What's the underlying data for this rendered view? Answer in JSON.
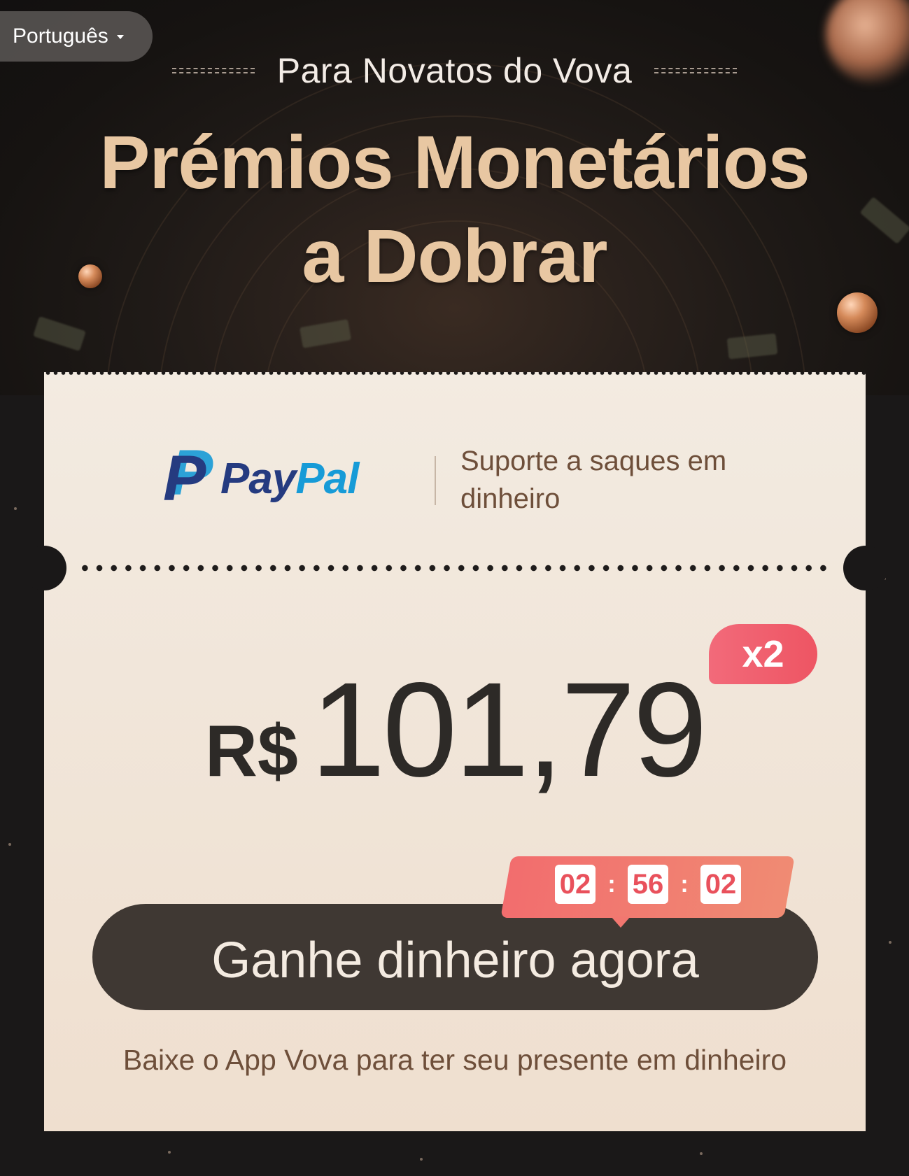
{
  "language_selector": {
    "label": "Português"
  },
  "header": {
    "subheading": "Para Novatos do Vova",
    "title_line1": "Prémios Monetários",
    "title_line2": "a Dobrar"
  },
  "card": {
    "paypal": {
      "word_pay": "Pay",
      "word_pal": "Pal",
      "mark": "P"
    },
    "support_text": "Suporte a saques em dinheiro",
    "amount": {
      "currency": "R$",
      "value": "101,79"
    },
    "multiplier": "x2",
    "timer": {
      "hours": "02",
      "minutes": "56",
      "seconds": "02",
      "separator": ":"
    },
    "cta_label": "Ganhe dinheiro agora",
    "footer_text": "Baixe o App Vova para ter seu presente em dinheiro"
  },
  "colors": {
    "title_gold": "#e8c7a2",
    "card_bg": "#f1e6da",
    "button_dark": "#3f3833",
    "accent_pink": "#f26a7a",
    "paypal_dark_blue": "#253b80",
    "paypal_light_blue": "#179bd7"
  }
}
